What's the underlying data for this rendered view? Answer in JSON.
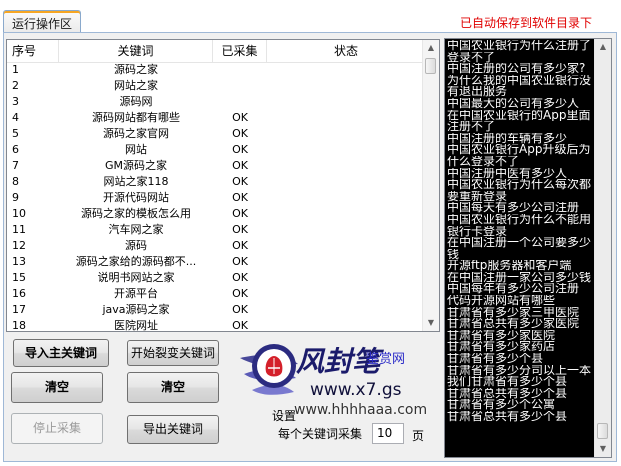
{
  "tab": {
    "label": "运行操作区"
  },
  "autosave_note": "已自动保存到软件目录下",
  "table": {
    "columns": [
      "序号",
      "关键词",
      "已采集",
      "状态"
    ],
    "rows": [
      [
        "1",
        "源码之家",
        "",
        ""
      ],
      [
        "2",
        "网站之家",
        "",
        ""
      ],
      [
        "3",
        "源码网",
        "",
        ""
      ],
      [
        "4",
        "源码网站都有哪些",
        "OK",
        ""
      ],
      [
        "5",
        "源码之家官网",
        "OK",
        ""
      ],
      [
        "6",
        "网站",
        "OK",
        ""
      ],
      [
        "7",
        "GM源码之家",
        "OK",
        ""
      ],
      [
        "8",
        "网站之家118",
        "OK",
        ""
      ],
      [
        "9",
        "开源代码网站",
        "OK",
        ""
      ],
      [
        "10",
        "源码之家的模板怎么用",
        "OK",
        ""
      ],
      [
        "11",
        "汽车网之家",
        "OK",
        ""
      ],
      [
        "12",
        "源码",
        "OK",
        ""
      ],
      [
        "13",
        "源码之家给的源码都不...",
        "OK",
        ""
      ],
      [
        "15",
        "说明书网站之家",
        "OK",
        ""
      ],
      [
        "16",
        "开源平台",
        "OK",
        ""
      ],
      [
        "17",
        "java源码之家",
        "OK",
        ""
      ],
      [
        "18",
        "医院网址",
        "OK",
        ""
      ]
    ]
  },
  "buttons": {
    "import": "导入主关键词",
    "start": "开始裂变关键词",
    "clear_left": "清空",
    "clear_right": "清空",
    "stop": "停止采集",
    "export": "导出关键词"
  },
  "settings": {
    "label": "设置",
    "per_keyword_label": "每个关键词采集",
    "per_keyword_value": "10",
    "unit": "页"
  },
  "console_lines": [
    "中国农业银行为什么注册了",
    "登录不了",
    "中国注册的公司有多少家?",
    "为什么我的中国农业银行没",
    "有退出服务",
    "中国最大的公司有多少人",
    "在中国农业银行的App里面",
    "注册不了",
    "中国注册的车辆有多少",
    "中国农业银行App升级后为",
    "什么登录不了",
    "中国注册中医有多少人",
    "中国农业银行为什么每次都",
    "要重新登录",
    "中国每天有多少公司注册",
    "中国农业银行为什么不能用",
    "银行卡登录",
    "在中国注册一个公司要多少",
    "钱",
    "开源ftp服务器和客户端",
    "在中国注册一家公司多少钱",
    "中国每年有多少公司注册",
    "代码开源网站有哪些",
    "甘肃省有多少家三甲医院",
    "甘肃省总共有多少家医院",
    "甘肃省有多少家医院",
    "甘肃省有多少家药店",
    "甘肃省有多少个县",
    "甘肃省有多少分司以上一本",
    "我们甘肃省有多少个县",
    "甘肃省总共有多少个县",
    "甘肃省有多少个公寓",
    "甘肃省总共有多少个县"
  ],
  "watermark": {
    "title": "风封笔",
    "sub": "鉴赏网",
    "url1": "www.x7.gs",
    "url2": "www.hhhhaaa.com"
  }
}
